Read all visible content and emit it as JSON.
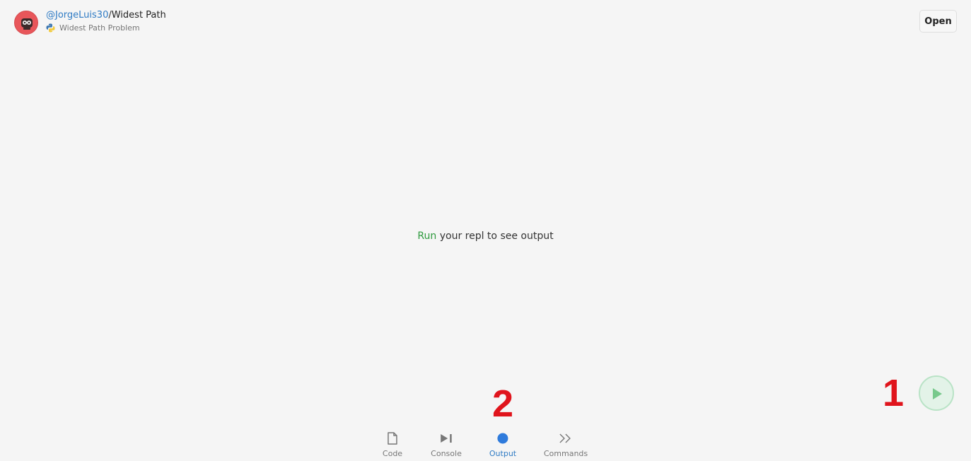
{
  "header": {
    "owner": "@JorgeLuis30",
    "separator": "/",
    "repl_name": "Widest Path",
    "description": "Widest Path Problem",
    "language_icon": "python-icon",
    "open_label": "Open"
  },
  "main": {
    "run_word": "Run",
    "message_rest": " your repl to see output"
  },
  "run_button": {
    "icon": "play-icon",
    "color": "#2e9a3e"
  },
  "annotations": {
    "one": "1",
    "two": "2",
    "color": "#e0141c"
  },
  "tabs": [
    {
      "label": "Code",
      "icon": "file-icon",
      "active": false
    },
    {
      "label": "Console",
      "icon": "console-icon",
      "active": false
    },
    {
      "label": "Output",
      "icon": "output-dot-icon",
      "active": true
    },
    {
      "label": "Commands",
      "icon": "commands-icon",
      "active": false
    }
  ],
  "colors": {
    "accent": "#2f7bc4",
    "run_green": "#2e9a3e",
    "background": "#f5f5f5"
  }
}
